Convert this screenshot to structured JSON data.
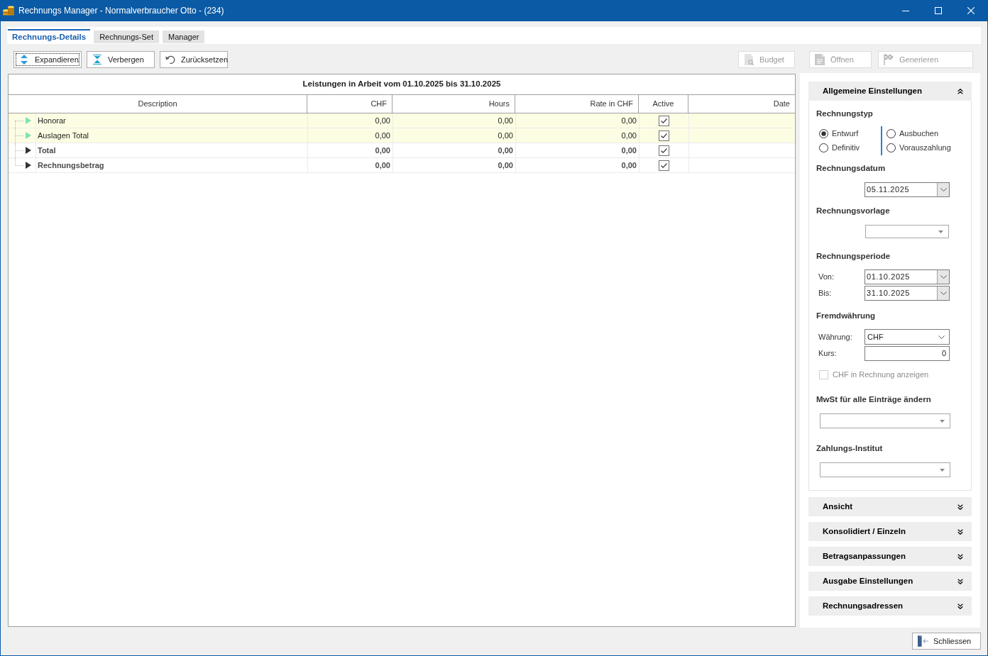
{
  "window": {
    "title": "Rechnungs Manager - Normalverbraucher Otto - (234)"
  },
  "tabs": [
    {
      "label": "Rechnungs-Details",
      "selected": true
    },
    {
      "label": "Rechnungs-Set",
      "selected": false
    },
    {
      "label": "Manager",
      "selected": false
    }
  ],
  "toolbar": {
    "left": [
      {
        "kind": "expand",
        "label": "Expandieren",
        "disabled": false,
        "focused": true
      },
      {
        "kind": "collapse",
        "label": "Verbergen",
        "disabled": false,
        "focused": false
      },
      {
        "kind": "reset",
        "label": "Zurücksetzen",
        "disabled": false,
        "focused": false
      }
    ],
    "right": [
      {
        "kind": "budget",
        "label": "Budget",
        "disabled": true,
        "focused": false
      },
      {
        "kind": "open",
        "label": "Öffnen",
        "disabled": true,
        "focused": false
      },
      {
        "kind": "generate",
        "label": "Generieren",
        "disabled": true,
        "focused": false
      }
    ]
  },
  "table": {
    "title": "Leistungen in Arbeit vom 01.10.2025 bis 31.10.2025",
    "columns": [
      "Description",
      "CHF",
      "Hours",
      "Rate in CHF",
      "Active",
      "Date"
    ],
    "rows": [
      {
        "kind": "item",
        "expanded": false,
        "description": "Honorar",
        "chf": "0,00",
        "hours": "0,00",
        "rate": "0,00",
        "active": true
      },
      {
        "kind": "item",
        "expanded": false,
        "description": "Auslagen Total",
        "chf": "0,00",
        "hours": "0,00",
        "rate": "0,00",
        "active": true
      },
      {
        "kind": "total",
        "expanded": false,
        "description": "Total",
        "chf": "0,00",
        "hours": "0,00",
        "rate": "0,00",
        "active": true
      },
      {
        "kind": "total",
        "expanded": false,
        "description": "Rechnungsbetrag",
        "chf": "0,00",
        "hours": "0,00",
        "rate": "0,00",
        "active": true
      }
    ]
  },
  "settings_panel": {
    "sections": [
      {
        "title": "Allgemeine Einstellungen",
        "expanded": true,
        "content": {
          "invoice_type": {
            "heading": "Rechnungstyp",
            "options": [
              {
                "label": "Entwurf",
                "selected": true
              },
              {
                "label": "Definitiv",
                "selected": false
              },
              {
                "label": "Ausbuchen",
                "selected": false
              },
              {
                "label": "Vorauszahlung",
                "selected": false
              }
            ]
          },
          "invoice_date": {
            "heading": "Rechnungsdatum",
            "value": "05.11.2025"
          },
          "invoice_template": {
            "heading": "Rechnungsvorlage"
          },
          "invoice_period": {
            "heading": "Rechnungsperiode",
            "from": {
              "label": "Von:",
              "value": "01.10.2025"
            },
            "to": {
              "label": "Bis:",
              "value": "31.10.2025"
            }
          },
          "foreign_currency": {
            "heading": "Fremdwährung",
            "currency": {
              "label": "Währung:",
              "value": "CHF"
            },
            "rate": {
              "label": "Kurs:",
              "value": "0"
            },
            "show_in_invoice": {
              "label": "CHF in Rechnung anzeigen",
              "checked": false,
              "disabled": true
            }
          },
          "vat_change": {
            "heading": "MwSt für alle Einträge ändern"
          },
          "payment_institute": {
            "heading": "Zahlungs-Institut"
          }
        }
      },
      {
        "title": "Ansicht",
        "expanded": false
      },
      {
        "title": "Konsolidiert / Einzeln",
        "expanded": false
      },
      {
        "title": "Betragsanpassungen",
        "expanded": false
      },
      {
        "title": "Ausgabe Einstellungen",
        "expanded": false
      },
      {
        "title": "Rechnungsadressen",
        "expanded": false
      }
    ]
  },
  "footer": {
    "close_button": {
      "label": "Schliessen"
    }
  }
}
